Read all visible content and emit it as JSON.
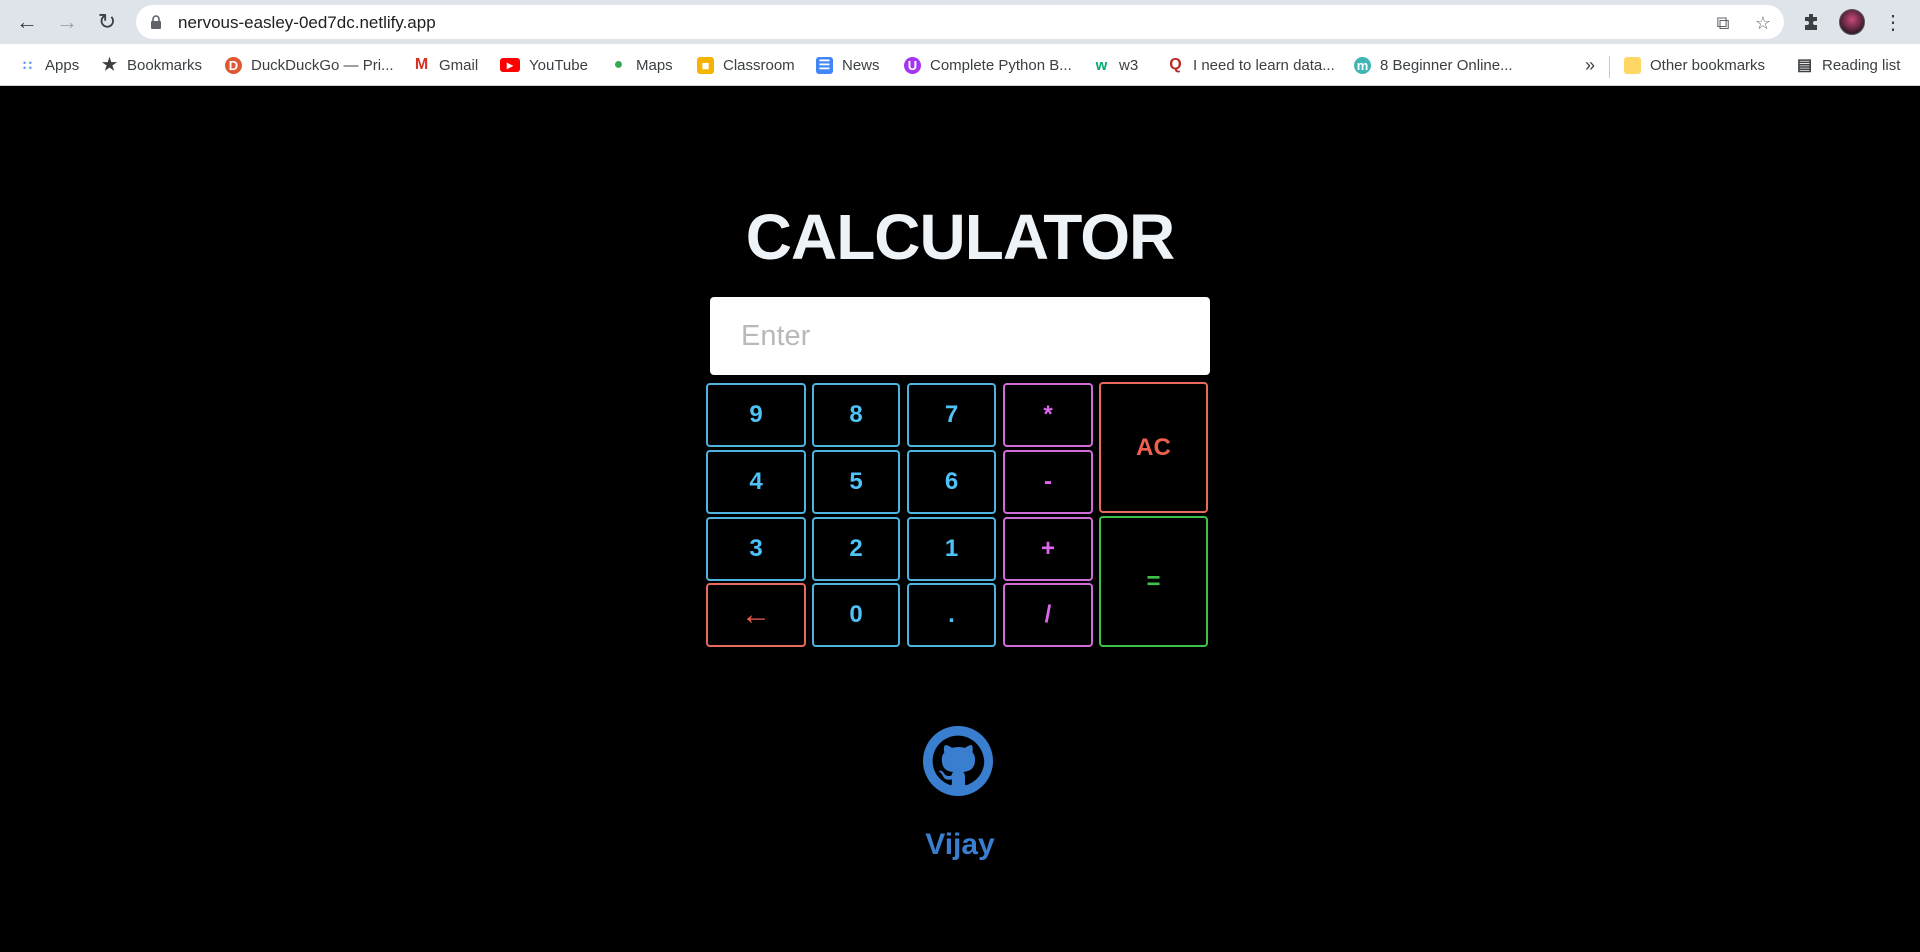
{
  "browser": {
    "url": "nervous-easley-0ed7dc.netlify.app",
    "bookmarks": [
      {
        "label": "Apps"
      },
      {
        "label": "Bookmarks"
      },
      {
        "label": "DuckDuckGo — Pri..."
      },
      {
        "label": "Gmail"
      },
      {
        "label": "YouTube"
      },
      {
        "label": "Maps"
      },
      {
        "label": "Classroom"
      },
      {
        "label": "News"
      },
      {
        "label": "Complete Python B..."
      },
      {
        "label": "w3"
      },
      {
        "label": "I need to learn data..."
      },
      {
        "label": "8 Beginner Online..."
      }
    ],
    "overflow_label": "»",
    "other_bookmarks": "Other bookmarks",
    "reading_list": "Reading list"
  },
  "calculator": {
    "title": "CALCULATOR",
    "placeholder": "Enter",
    "keys": {
      "k9": "9",
      "k8": "8",
      "k7": "7",
      "mul": "*",
      "ac": "AC",
      "k4": "4",
      "k5": "5",
      "k6": "6",
      "sub": "-",
      "k3": "3",
      "k2": "2",
      "k1": "1",
      "add": "+",
      "eq": "=",
      "back": "←",
      "k0": "0",
      "dot": ".",
      "div": "/"
    },
    "colors": {
      "number": "#4fc3f7",
      "operator": "#e066ef",
      "clear": "#f0604d",
      "equals": "#3cc24a"
    }
  },
  "footer": {
    "author": "Vijay",
    "icon": "github-icon"
  }
}
